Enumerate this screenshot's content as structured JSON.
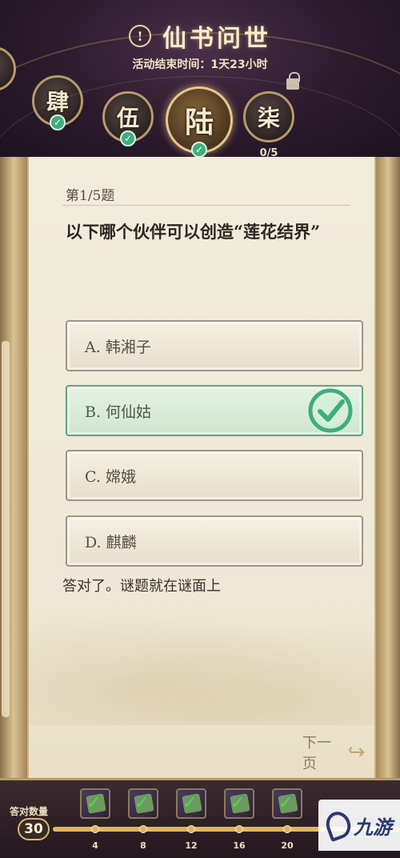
{
  "header": {
    "title": "仙书问世",
    "countdown": "活动结束时间：1天23小时",
    "info_icon": "info-icon",
    "chapters": [
      {
        "label": "肆",
        "completed": true
      },
      {
        "label": "伍",
        "completed": true
      },
      {
        "label": "陆",
        "completed": true,
        "active": true
      },
      {
        "label": "柒",
        "completed": false,
        "progress": "0/5",
        "locked": true
      }
    ]
  },
  "question": {
    "number": "第1/5题",
    "text": "以下哪个伙伴可以创造“莲花结界”",
    "options": [
      {
        "label": "A. 韩湘子",
        "correct": false
      },
      {
        "label": "B. 何仙姑",
        "correct": true
      },
      {
        "label": "C. 嫦娥",
        "correct": false
      },
      {
        "label": "D. 麒麟",
        "correct": false
      }
    ],
    "feedback": "答对了。谜题就在谜面上",
    "next_label": "下一页"
  },
  "footer": {
    "score_label": "答对数量",
    "score": "30",
    "progress_fraction": 1.0,
    "ticks": [
      "4",
      "8",
      "12",
      "16",
      "20"
    ],
    "brand_text": "九游",
    "colors": {
      "accent": "#e3b55a",
      "correct": "#3fae7c"
    }
  }
}
